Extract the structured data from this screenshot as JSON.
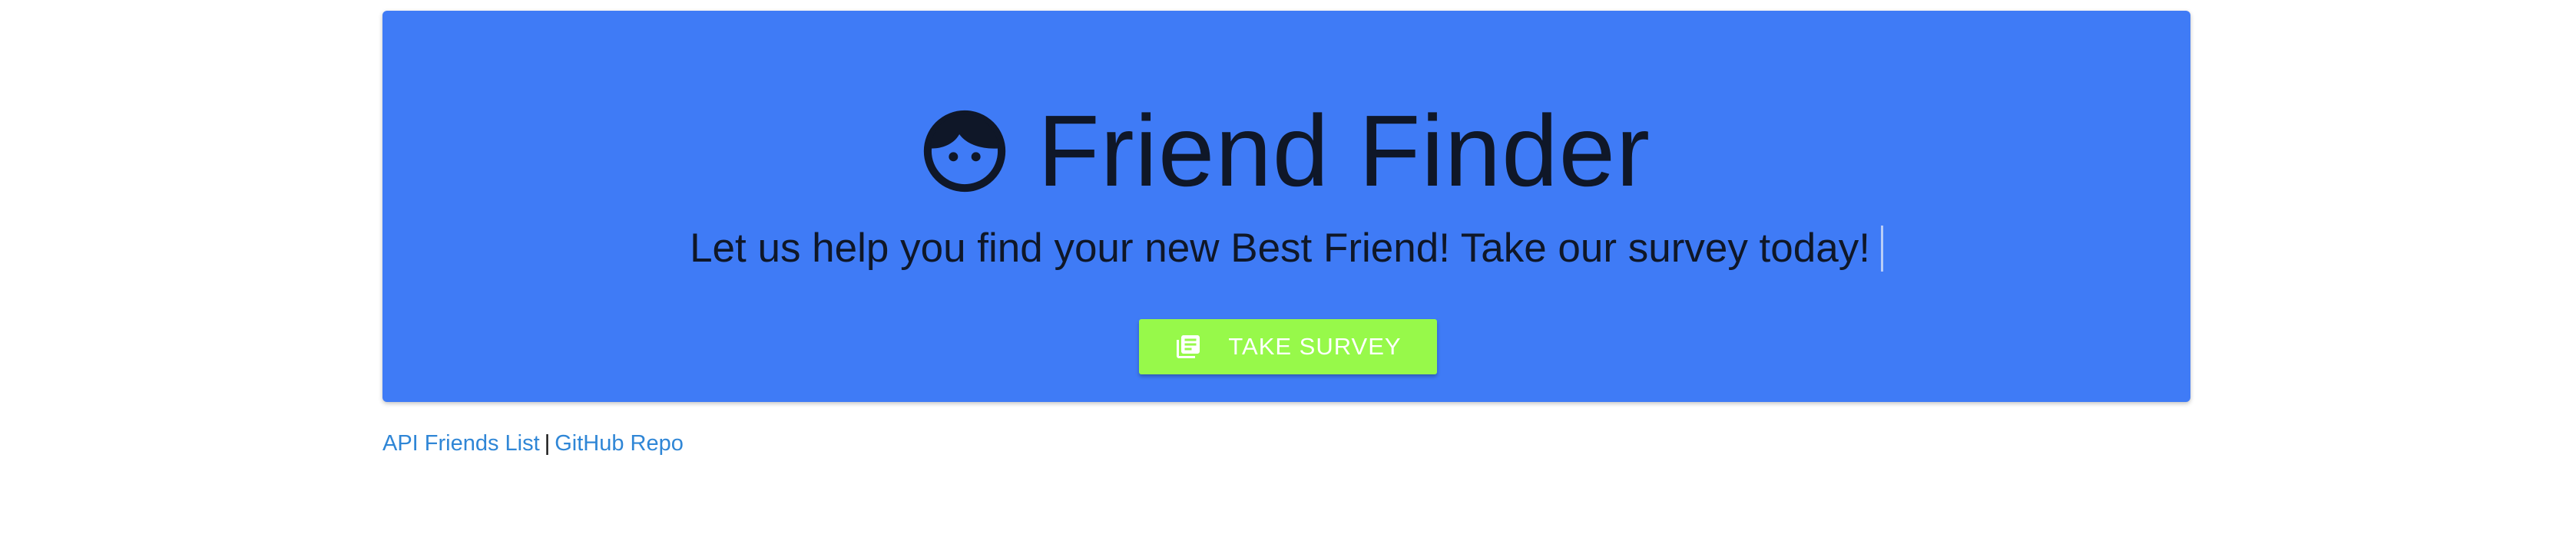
{
  "hero": {
    "title": "Friend Finder",
    "subtitle": "Let us help you find your new Best Friend! Take our survey today!",
    "title_icon": "face-icon",
    "background_color": "#3f7bf6"
  },
  "survey_button": {
    "label": "TAKE SURVEY",
    "icon": "library-books-icon",
    "background_color": "#97f94a"
  },
  "footer": {
    "api_link_label": "API Friends List",
    "separator": "|",
    "github_link_label": "GitHub Repo"
  }
}
